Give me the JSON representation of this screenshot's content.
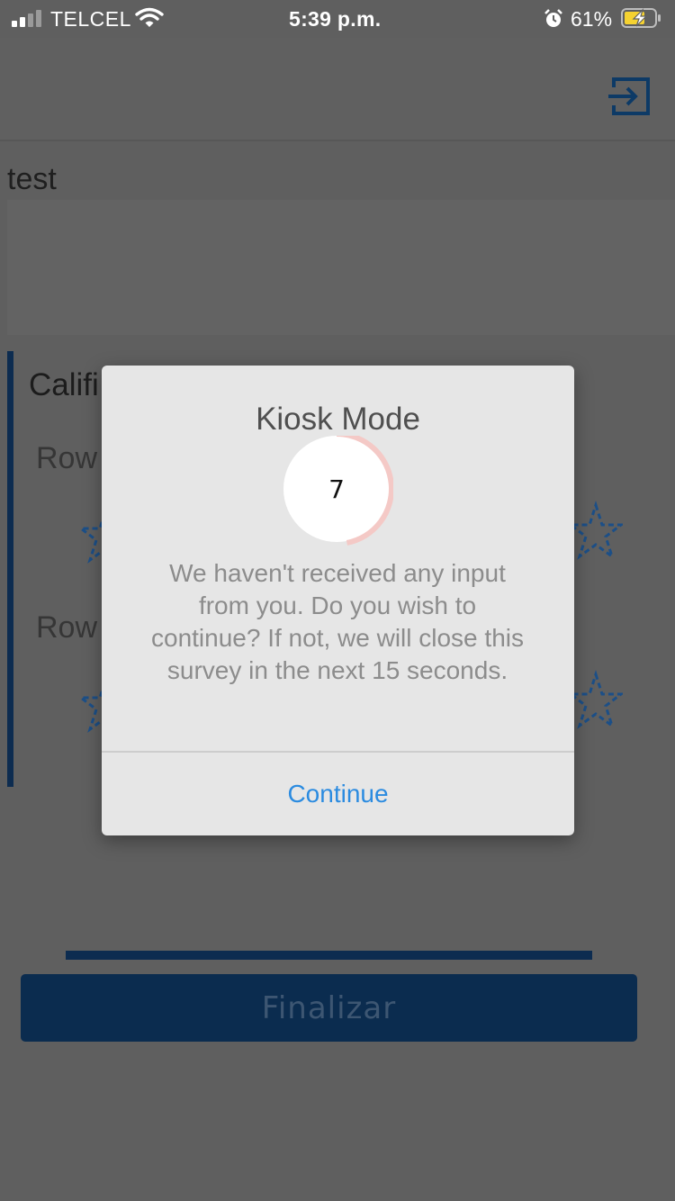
{
  "status_bar": {
    "carrier": "TELCEL",
    "time": "5:39 p.m.",
    "battery_percent": "61%",
    "icons": [
      "signal-icon",
      "wifi-icon",
      "alarm-icon",
      "battery-charging-icon"
    ]
  },
  "header": {
    "exit_icon": "exit-icon",
    "accent_color": "#1a4f86"
  },
  "survey": {
    "title": "test",
    "question_label": "Califi",
    "rows": [
      {
        "label": "Row"
      },
      {
        "label": "Row"
      }
    ],
    "star_icon": "star-icon",
    "finish_label": "Finalizar",
    "primary_color": "#0b2c4f"
  },
  "modal": {
    "title": "Kiosk Mode",
    "countdown": "7",
    "countdown_progress": 0.47,
    "countdown_color": "#f4c9c6",
    "message": "We haven't received any input from you. Do you wish to continue? If not, we will close this survey in the next 15 seconds.",
    "continue_label": "Continue",
    "continue_color": "#2b8be0"
  }
}
